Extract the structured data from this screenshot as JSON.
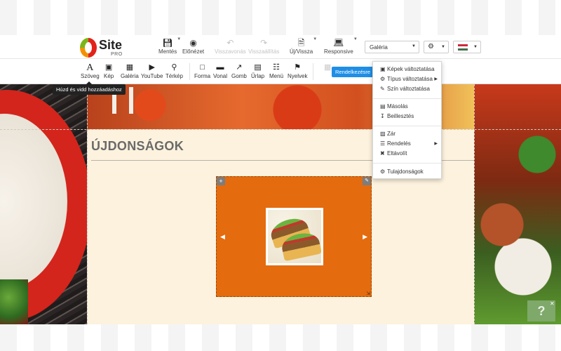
{
  "brand": {
    "name": "Site",
    "tier": "PRO"
  },
  "toolbar": {
    "save": "Mentés",
    "preview": "Előnézet",
    "undo": "Visszavonás",
    "redo": "Visszaállítás",
    "new_back": "Új/Vissza",
    "responsive": "Responsive",
    "page_select_value": "Galéria"
  },
  "elements": {
    "text": "Szöveg",
    "image": "Kép",
    "gallery": "Galéria",
    "youtube": "YouTube",
    "map": "Térkép",
    "shape": "Forma",
    "line": "Vonal",
    "button": "Gomb",
    "form": "Űrlap",
    "menu": "Menü",
    "languages": "Nyelvek"
  },
  "tooltips": {
    "drag": "Húzd és vidd hozzáadáshoz",
    "arrange": "Rendelkezésre"
  },
  "content": {
    "section_title": "ÚJDONSÁGOK"
  },
  "context_menu": {
    "items": [
      {
        "label": "Képek változtatása",
        "icon": "image-icon"
      },
      {
        "label": "Típus változtatása",
        "icon": "gear-icon",
        "submenu": true
      },
      {
        "label": "Szín változtatása",
        "icon": "edit-square-icon"
      },
      {
        "label": "Másolás",
        "icon": "copy-icon"
      },
      {
        "label": "Beillesztés",
        "icon": "paste-icon"
      },
      {
        "label": "Zár",
        "icon": "lock-icon"
      },
      {
        "label": "Rendelés",
        "icon": "list-icon",
        "submenu": true
      },
      {
        "label": "Eltávolít",
        "icon": "close-icon"
      },
      {
        "label": "Tulajdonságok",
        "icon": "gear-icon"
      }
    ]
  },
  "help": {
    "label": "?"
  },
  "colors": {
    "accent_blue": "#1e8ee6",
    "gallery_orange": "#e46b0e",
    "content_cream": "#fdf2de"
  }
}
